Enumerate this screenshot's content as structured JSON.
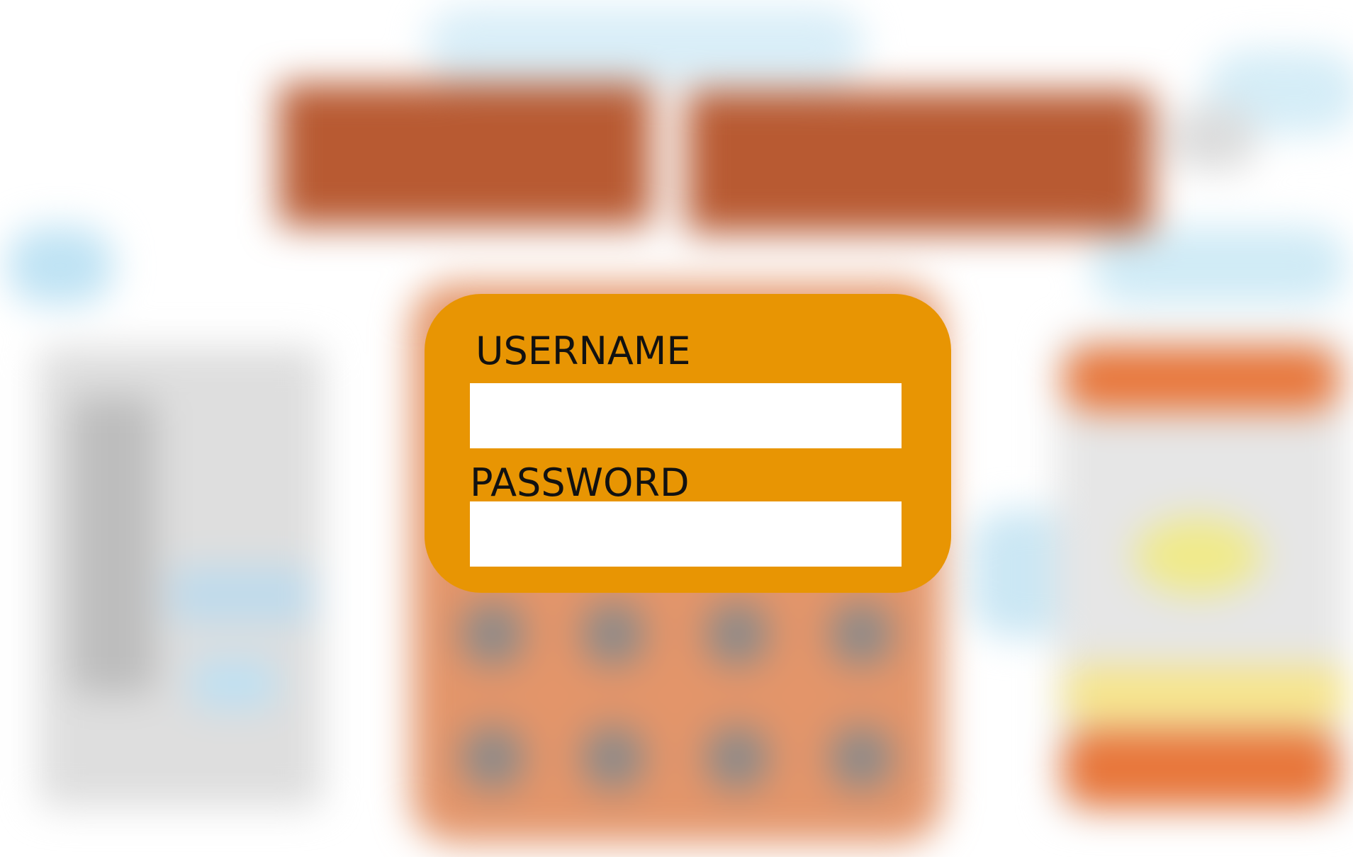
{
  "login": {
    "username_label": "USERNAME",
    "password_label": "PASSWORD",
    "username_value": "",
    "password_value": "",
    "card_color": "#e89503"
  },
  "background": {
    "blurred": true,
    "accent": "#e8763a"
  }
}
